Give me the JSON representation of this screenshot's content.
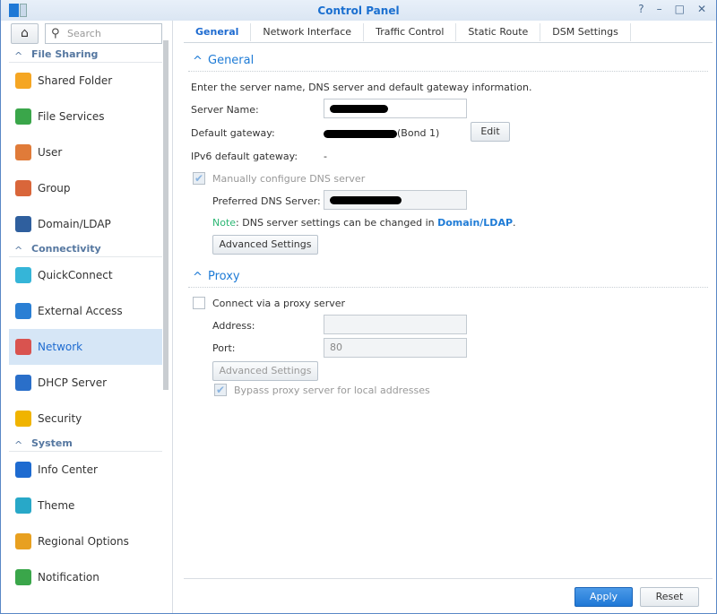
{
  "window": {
    "title": "Control Panel",
    "buttons": [
      "?",
      "–",
      "□",
      "✕"
    ]
  },
  "sidebar": {
    "search_placeholder": "Search",
    "sections": [
      {
        "label": "File Sharing",
        "items": [
          {
            "label": "Shared Folder",
            "color": "#f5a623"
          },
          {
            "label": "File Services",
            "color": "#3aa64a"
          },
          {
            "label": "User",
            "color": "#e07b39"
          },
          {
            "label": "Group",
            "color": "#d9663a"
          },
          {
            "label": "Domain/LDAP",
            "color": "#2f5f9e"
          }
        ]
      },
      {
        "label": "Connectivity",
        "items": [
          {
            "label": "QuickConnect",
            "color": "#35b5d8"
          },
          {
            "label": "External Access",
            "color": "#2a7fd4"
          },
          {
            "label": "Network",
            "color": "#d9534f"
          },
          {
            "label": "DHCP Server",
            "color": "#2a6fc9"
          },
          {
            "label": "Security",
            "color": "#f0b400"
          }
        ]
      },
      {
        "label": "System",
        "items": [
          {
            "label": "Info Center",
            "color": "#1e6bd0"
          },
          {
            "label": "Theme",
            "color": "#28a8c8"
          },
          {
            "label": "Regional Options",
            "color": "#e8a020"
          },
          {
            "label": "Notification",
            "color": "#3aa64a"
          }
        ]
      }
    ]
  },
  "tabs": [
    "General",
    "Network Interface",
    "Traffic Control",
    "Static Route",
    "DSM Settings"
  ],
  "general": {
    "heading": "General",
    "description": "Enter the server name, DNS server and default gateway information.",
    "server_name_label": "Server Name:",
    "gateway_label": "Default gateway:",
    "gateway_suffix": "(Bond 1)",
    "edit": "Edit",
    "ipv6_label": "IPv6 default gateway:",
    "ipv6_value": "-",
    "dns_checkbox": "Manually configure DNS server",
    "dns_checked": true,
    "preferred_dns_label": "Preferred DNS Server:",
    "note_prefix": "Note",
    "note_text": ": DNS server settings can be changed in ",
    "note_link": "Domain/LDAP",
    "note_end": ".",
    "advanced": "Advanced Settings"
  },
  "proxy": {
    "heading": "Proxy",
    "connect_label": "Connect via a proxy server",
    "connect_checked": false,
    "address_label": "Address:",
    "address_value": "",
    "port_label": "Port:",
    "port_value": "80",
    "advanced": "Advanced Settings",
    "bypass_label": "Bypass proxy server for local addresses",
    "bypass_checked": true
  },
  "footer": {
    "apply": "Apply",
    "reset": "Reset"
  }
}
